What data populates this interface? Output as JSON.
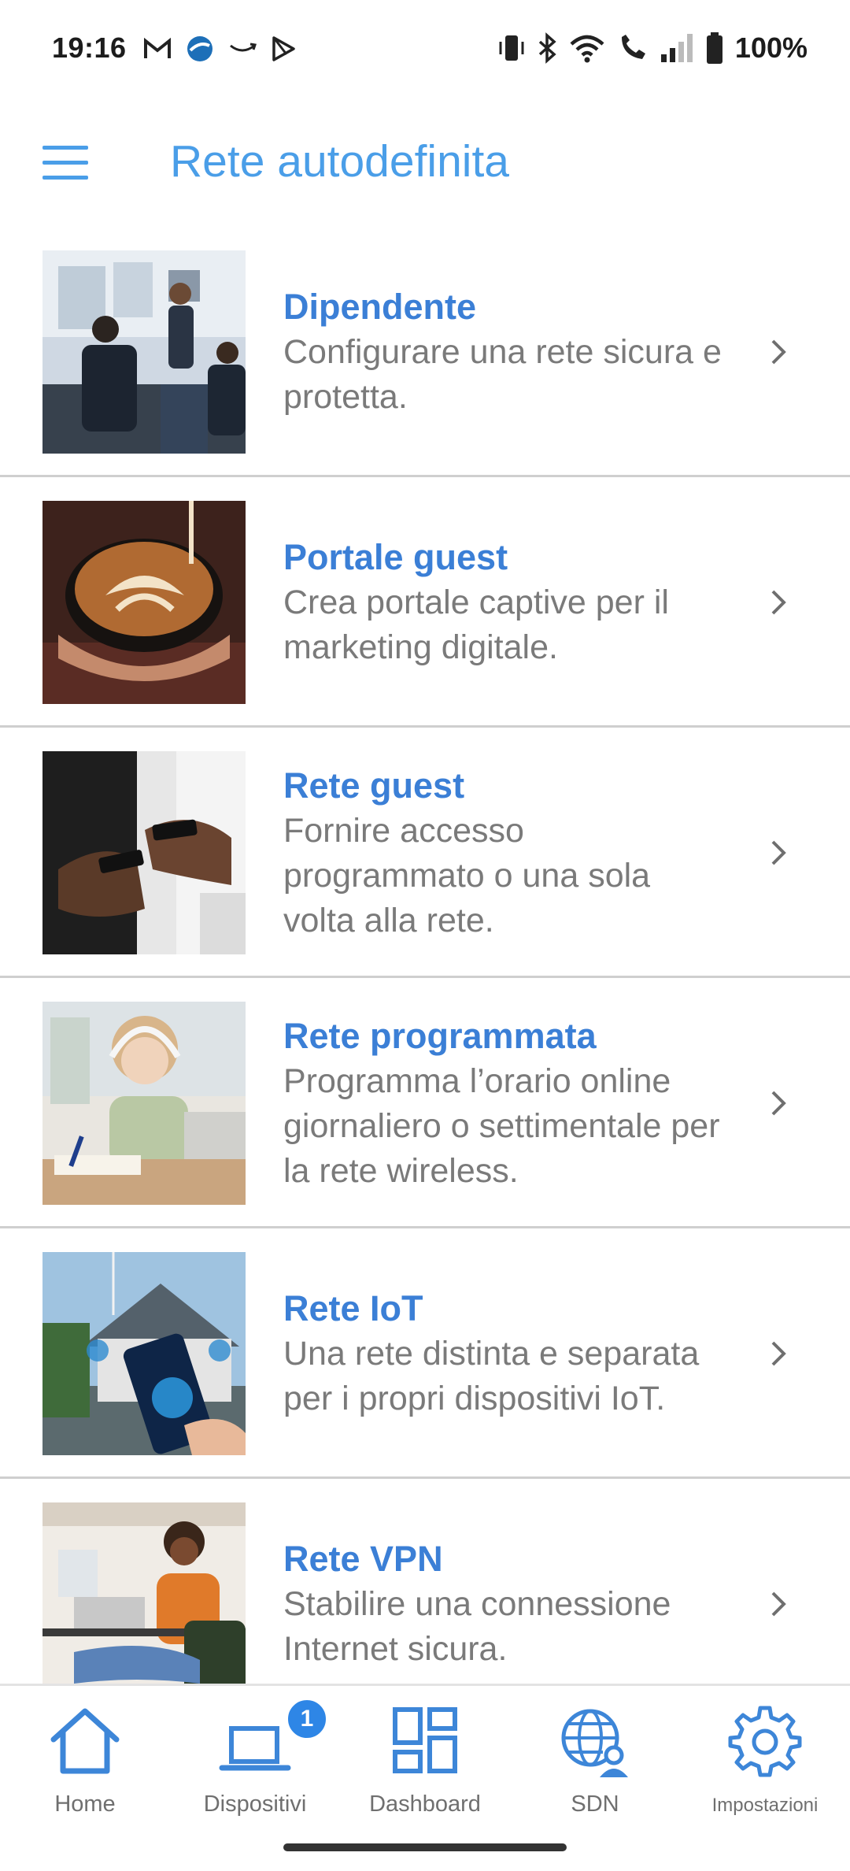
{
  "status_bar": {
    "time": "19:16",
    "battery": "100%",
    "left_icons": [
      "gmail-icon",
      "app-globe-icon",
      "amazon-icon",
      "play-store-icon"
    ],
    "right_icons": [
      "vibrate-icon",
      "bluetooth-icon",
      "wifi-icon",
      "wifi-call-icon",
      "signal-icon",
      "battery-icon"
    ]
  },
  "app_bar": {
    "title": "Rete autodefinita",
    "menu_icon": "hamburger-menu-icon"
  },
  "colors": {
    "accent": "#4a9ee8",
    "title_blue": "#3b7fd6",
    "description_gray": "#7a7a7a",
    "badge_blue": "#2e86e6"
  },
  "items": [
    {
      "title": "Dipendente",
      "description": "Configurare una rete sicura e protetta.",
      "image": "office-meeting-photo"
    },
    {
      "title": "Portale guest",
      "description": "Crea portale captive per il marketing digitale.",
      "image": "latte-art-photo"
    },
    {
      "title": "Rete guest",
      "description": "Fornire accesso programmato o una sola volta alla rete.",
      "image": "people-using-phones-photo"
    },
    {
      "title": "Rete programmata",
      "description": "Programma l’orario online giornaliero o settimentale per la rete wireless.",
      "image": "girl-studying-photo"
    },
    {
      "title": "Rete IoT",
      "description": "Una rete distinta e separata per i propri dispositivi IoT.",
      "image": "smart-home-phone-photo"
    },
    {
      "title": "Rete VPN",
      "description": "Stabilire una connessione Internet sicura.",
      "image": "woman-laptop-headphones-photo"
    }
  ],
  "bottom_nav": [
    {
      "label": "Home",
      "icon": "home-icon"
    },
    {
      "label": "Dispositivi",
      "icon": "devices-icon",
      "badge": "1"
    },
    {
      "label": "Dashboard",
      "icon": "dashboard-icon"
    },
    {
      "label": "SDN",
      "icon": "sdn-globe-user-icon"
    },
    {
      "label": "Impostazioni",
      "icon": "gear-icon"
    }
  ]
}
